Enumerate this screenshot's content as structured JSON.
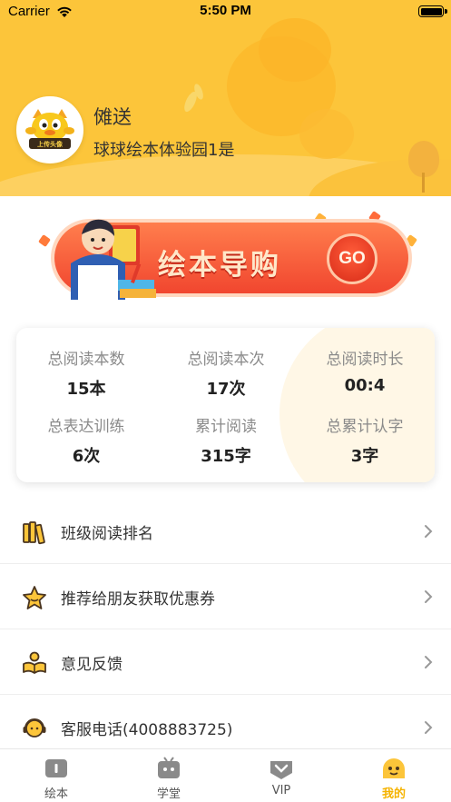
{
  "status_bar": {
    "carrier": "Carrier",
    "time": "5:50 PM"
  },
  "profile": {
    "name": "傩送",
    "school": "球球绘本体验园1是",
    "avatar_badge": "上传头像"
  },
  "banner": {
    "title": "绘本导购",
    "go_label": "GO"
  },
  "stats": [
    {
      "label": "总阅读本数",
      "value": "15本"
    },
    {
      "label": "总阅读本次",
      "value": "17次"
    },
    {
      "label": "总阅读时长",
      "value": "00:4"
    },
    {
      "label": "总表达训练",
      "value": "6次"
    },
    {
      "label": "累计阅读",
      "value": "315字"
    },
    {
      "label": "总累计认字",
      "value": "3字"
    }
  ],
  "menu": [
    {
      "label": "班级阅读排名",
      "icon": "books-icon"
    },
    {
      "label": "推荐给朋友获取优惠券",
      "icon": "star-icon"
    },
    {
      "label": "意见反馈",
      "icon": "feedback-icon"
    },
    {
      "label": "客服电话(4008883725)",
      "icon": "headset-icon"
    }
  ],
  "tabs": [
    {
      "label": "绘本",
      "icon": "book-icon",
      "active": false
    },
    {
      "label": "学堂",
      "icon": "tv-icon",
      "active": false
    },
    {
      "label": "VIP",
      "icon": "vip-icon",
      "active": false
    },
    {
      "label": "我的",
      "icon": "smile-icon",
      "active": true
    }
  ],
  "colors": {
    "header_bg": "#fcc53a",
    "banner_red": "#f1462f",
    "active_tab": "#f5b300"
  }
}
